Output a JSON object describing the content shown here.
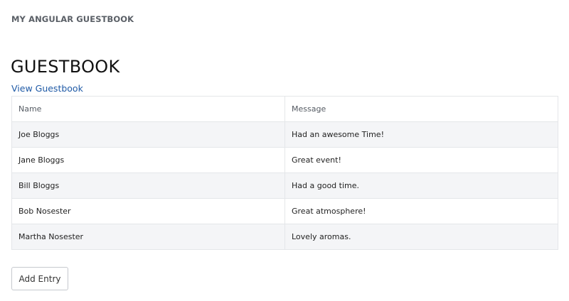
{
  "header": {
    "brand": "MY ANGULAR GUESTBOOK"
  },
  "main": {
    "title": "GUESTBOOK",
    "view_link": "View Guestbook",
    "table": {
      "columns": [
        "Name",
        "Message"
      ],
      "rows": [
        {
          "name": "Joe Bloggs",
          "message": "Had an awesome Time!"
        },
        {
          "name": "Jane Bloggs",
          "message": "Great event!"
        },
        {
          "name": "Bill Bloggs",
          "message": "Had a good time."
        },
        {
          "name": "Bob Nosester",
          "message": "Great atmosphere!"
        },
        {
          "name": "Martha Nosester",
          "message": "Lovely aromas."
        }
      ]
    },
    "add_button": "Add Entry"
  }
}
